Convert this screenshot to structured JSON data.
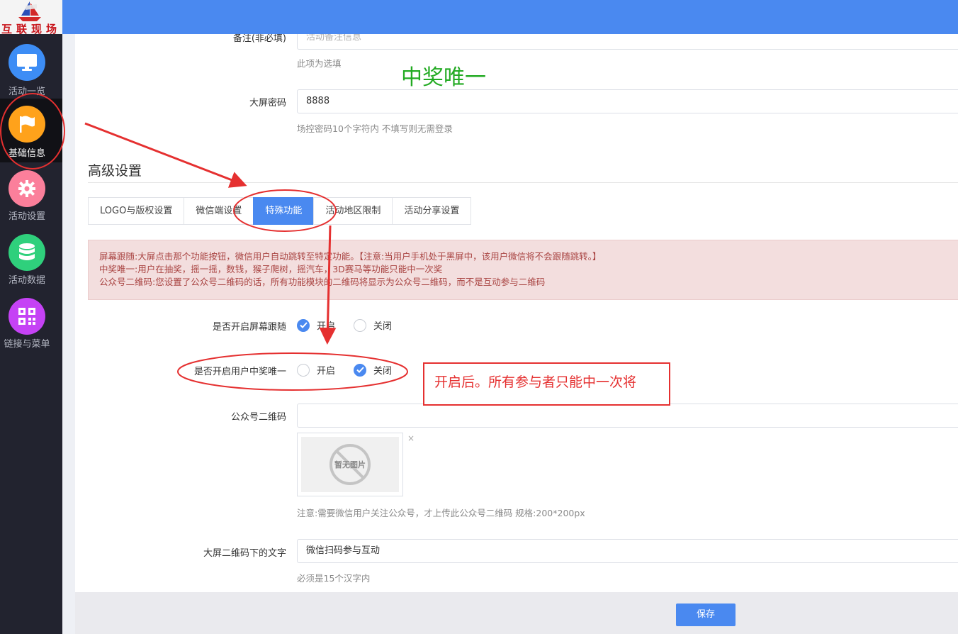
{
  "brand": {
    "logo_text": "互联现场"
  },
  "sidebar": {
    "items": [
      {
        "label": "活动一览",
        "icon": "monitor-icon",
        "color": "#3d8df5"
      },
      {
        "label": "基础信息",
        "icon": "flag-icon",
        "color": "#ffa21b"
      },
      {
        "label": "活动设置",
        "icon": "gear-icon",
        "color": "#fb7f9b"
      },
      {
        "label": "活动数据",
        "icon": "database-icon",
        "color": "#2fd07c"
      },
      {
        "label": "链接与菜单",
        "icon": "qrcode-icon",
        "color": "#c542f5"
      }
    ]
  },
  "form": {
    "remark": {
      "label": "备注(非必填)",
      "placeholder": "活动备注信息",
      "hint": "此项为选填"
    },
    "screen_password": {
      "label": "大屏密码",
      "value": "8888",
      "hint": "场控密码10个字符内 不填写则无需登录"
    },
    "advanced_title": "高级设置",
    "tabs": [
      {
        "label": "LOGO与版权设置"
      },
      {
        "label": "微信端设置"
      },
      {
        "label": "特殊功能"
      },
      {
        "label": "活动地区限制"
      },
      {
        "label": "活动分享设置"
      }
    ],
    "notice": {
      "line1": "屏幕跟随:大屏点击那个功能按钮，微信用户自动跳转至特定功能。【注意:当用户手机处于黑屏中，该用户微信将不会跟随跳转。】",
      "line2": "中奖唯一:用户在抽奖，摇一摇，数钱，猴子爬树，摇汽车，3D赛马等功能只能中一次奖",
      "line3": "公众号二维码:您设置了公众号二维码的话，所有功能模块的二维码将显示为公众号二维码，而不是互动参与二维码"
    },
    "screen_follow": {
      "label": "是否开启屏幕跟随",
      "on": "开启",
      "off": "关闭",
      "selected": "on"
    },
    "win_once": {
      "label": "是否开启用户中奖唯一",
      "on": "开启",
      "off": "关闭",
      "selected": "off"
    },
    "qrcode": {
      "label": "公众号二维码",
      "no_image": "暂无图片",
      "close": "×",
      "hint": "注意:需要微信用户关注公众号，才上传此公众号二维码 规格:200*200px"
    },
    "screen_text": {
      "label": "大屏二维码下的文字",
      "value": "微信扫码参与互动",
      "hint": "必须是15个汉字内"
    },
    "save_label": "保存"
  },
  "annotations": {
    "green_text": "中奖唯一",
    "red_box_text": "开启后。所有参与者只能中一次将"
  },
  "colors": {
    "accent": "#4a89f0",
    "sidebar_bg": "#22232f",
    "alert_bg": "#f3dede",
    "annotation_red": "#e53030",
    "annotation_green": "#22aa22"
  }
}
